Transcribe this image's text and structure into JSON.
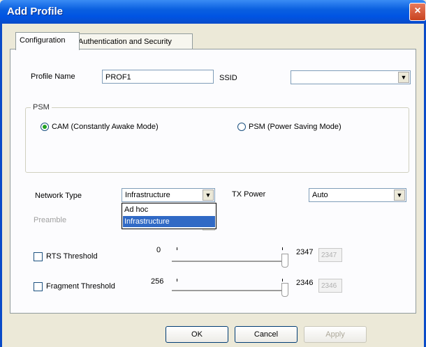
{
  "window": {
    "title": "Add Profile",
    "close_glyph": "×"
  },
  "tabs": [
    {
      "label": "Configuration",
      "active": true
    },
    {
      "label": "Authentication and Security",
      "active": false
    }
  ],
  "profile": {
    "name_label": "Profile Name",
    "name_value": "PROF1",
    "ssid_label": "SSID",
    "ssid_value": ""
  },
  "psm": {
    "group_label": "PSM",
    "options": [
      {
        "label": "CAM (Constantly Awake Mode)",
        "selected": true
      },
      {
        "label": "PSM (Power Saving Mode)",
        "selected": false
      }
    ]
  },
  "network": {
    "type_label": "Network Type",
    "type_value": "Infrastructure",
    "type_options": [
      "Ad hoc",
      "Infrastructure"
    ],
    "tx_power_label": "TX Power",
    "tx_power_value": "Auto",
    "preamble_label": "Preamble"
  },
  "rts": {
    "label": "RTS Threshold",
    "checked": false,
    "min": "0",
    "max": "2347",
    "value": "2347"
  },
  "fragment": {
    "label": "Fragment Threshold",
    "checked": false,
    "min": "256",
    "max": "2346",
    "value": "2346"
  },
  "buttons": {
    "ok": "OK",
    "cancel": "Cancel",
    "apply": "Apply"
  },
  "icons": {
    "combo_arrow": "chevron-down-icon",
    "close": "close-icon"
  }
}
